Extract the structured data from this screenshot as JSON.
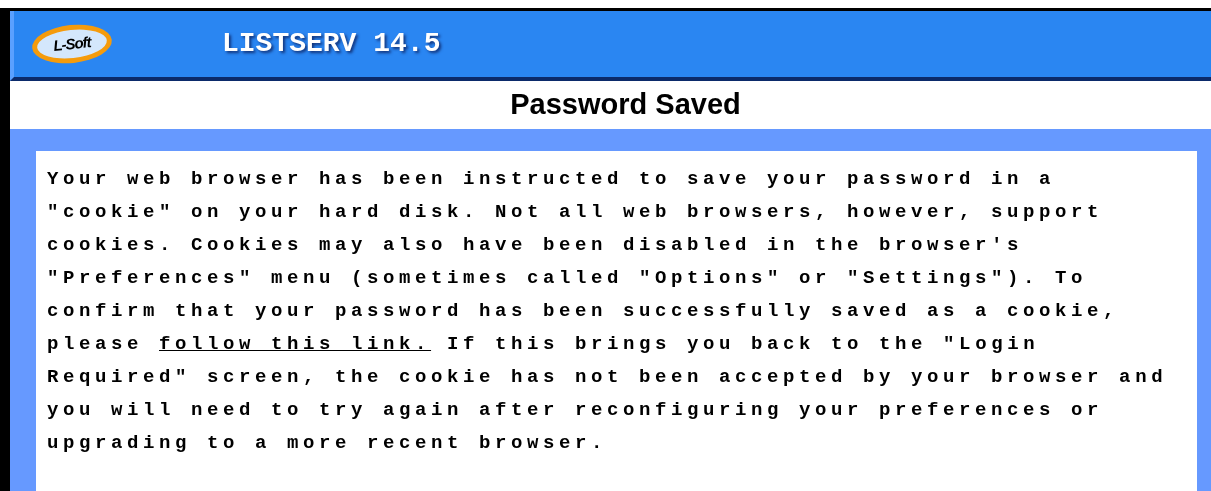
{
  "header": {
    "logo": "L-Soft",
    "product": "LISTSERV 14.5"
  },
  "page_title": "Password Saved",
  "message": {
    "before": "Your web browser has been instructed to save your password in a \"cookie\" on your hard disk. Not all web browsers, however, support cookies. Cookies may also have been disabled in the browser's \"Preferences\" menu (sometimes called \"Options\" or \"Settings\"). To confirm that your password has been successfully saved as a cookie, please",
    "link": "follow this link.",
    "after": "If this brings you back to the \"Login Required\" screen, the cookie has not been accepted by your browser and you will need to try again after reconfiguring your preferences or upgrading to a more recent browser."
  }
}
